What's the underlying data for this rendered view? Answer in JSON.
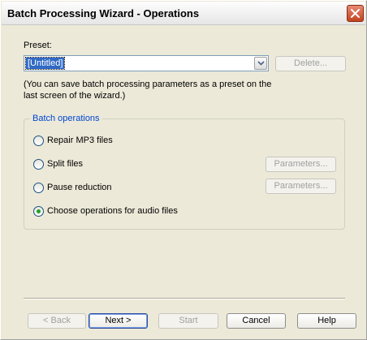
{
  "window": {
    "title": "Batch Processing Wizard - Operations"
  },
  "preset": {
    "label": "Preset:",
    "selected": "[Untitled]",
    "delete_label": "Delete..."
  },
  "hint": "(You can save batch processing parameters as a preset on the last screen of the wizard.)",
  "batch_operations": {
    "title": "Batch operations",
    "options": [
      {
        "label": "Repair MP3 files",
        "checked": false
      },
      {
        "label": "Split files",
        "checked": false,
        "parameters_label": "Parameters..."
      },
      {
        "label": "Pause reduction",
        "checked": false,
        "parameters_label": "Parameters..."
      },
      {
        "label": "Choose operations for audio files",
        "checked": true
      }
    ]
  },
  "footer": {
    "back_label": "< Back",
    "next_label": "Next >",
    "start_label": "Start",
    "cancel_label": "Cancel",
    "help_label": "Help"
  },
  "icons": {
    "close": "close-icon",
    "dropdown": "chevron-down-icon"
  }
}
